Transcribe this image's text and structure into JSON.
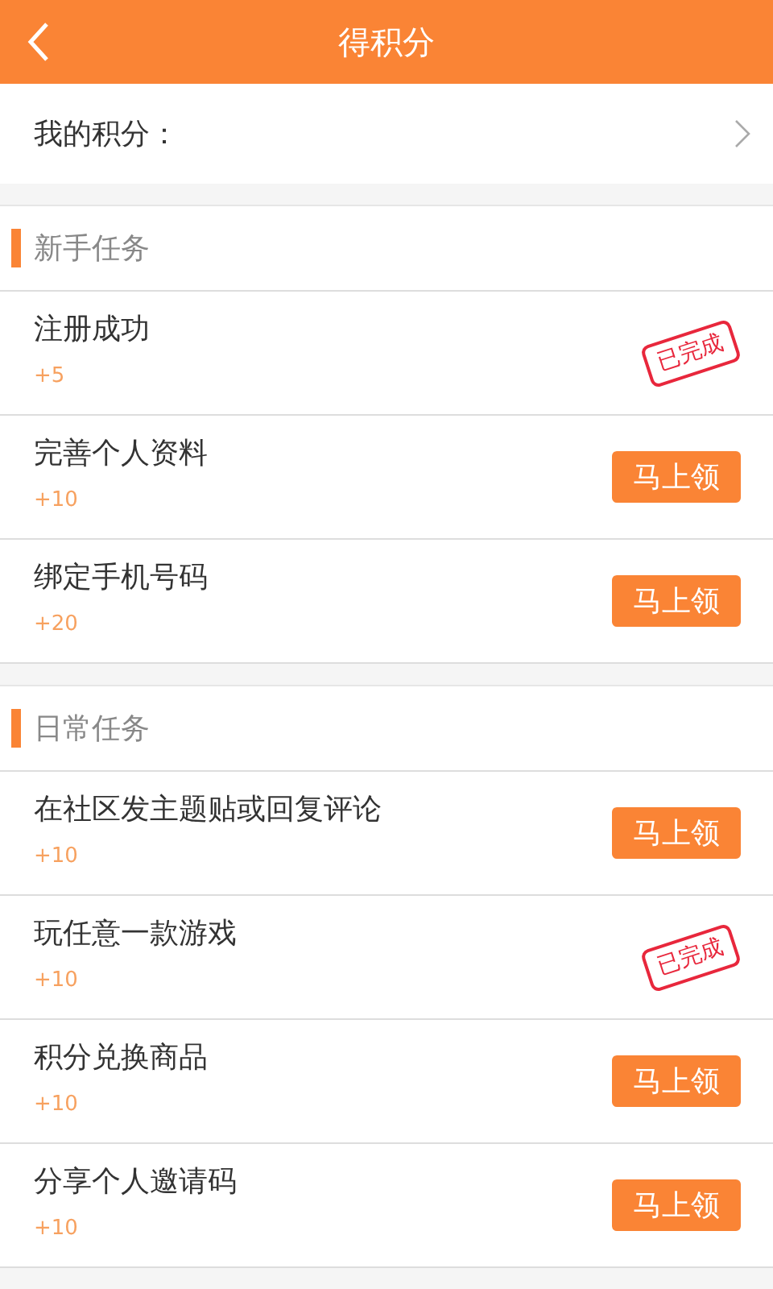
{
  "header": {
    "title": "得积分"
  },
  "my_points": {
    "label": "我的积分："
  },
  "sections": [
    {
      "title": "新手任务",
      "tasks": [
        {
          "name": "注册成功",
          "points": "+5",
          "kind": "done",
          "action": "已完成"
        },
        {
          "name": "完善个人资料",
          "points": "+10",
          "kind": "claim",
          "action": "马上领"
        },
        {
          "name": "绑定手机号码",
          "points": "+20",
          "kind": "claim",
          "action": "马上领"
        }
      ]
    },
    {
      "title": "日常任务",
      "tasks": [
        {
          "name": "在社区发主题贴或回复评论",
          "points": "+10",
          "kind": "claim",
          "action": "马上领"
        },
        {
          "name": "玩任意一款游戏",
          "points": "+10",
          "kind": "done",
          "action": "已完成"
        },
        {
          "name": "积分兑换商品",
          "points": "+10",
          "kind": "claim",
          "action": "马上领"
        },
        {
          "name": "分享个人邀请码",
          "points": "+10",
          "kind": "claim",
          "action": "马上领"
        }
      ]
    }
  ]
}
